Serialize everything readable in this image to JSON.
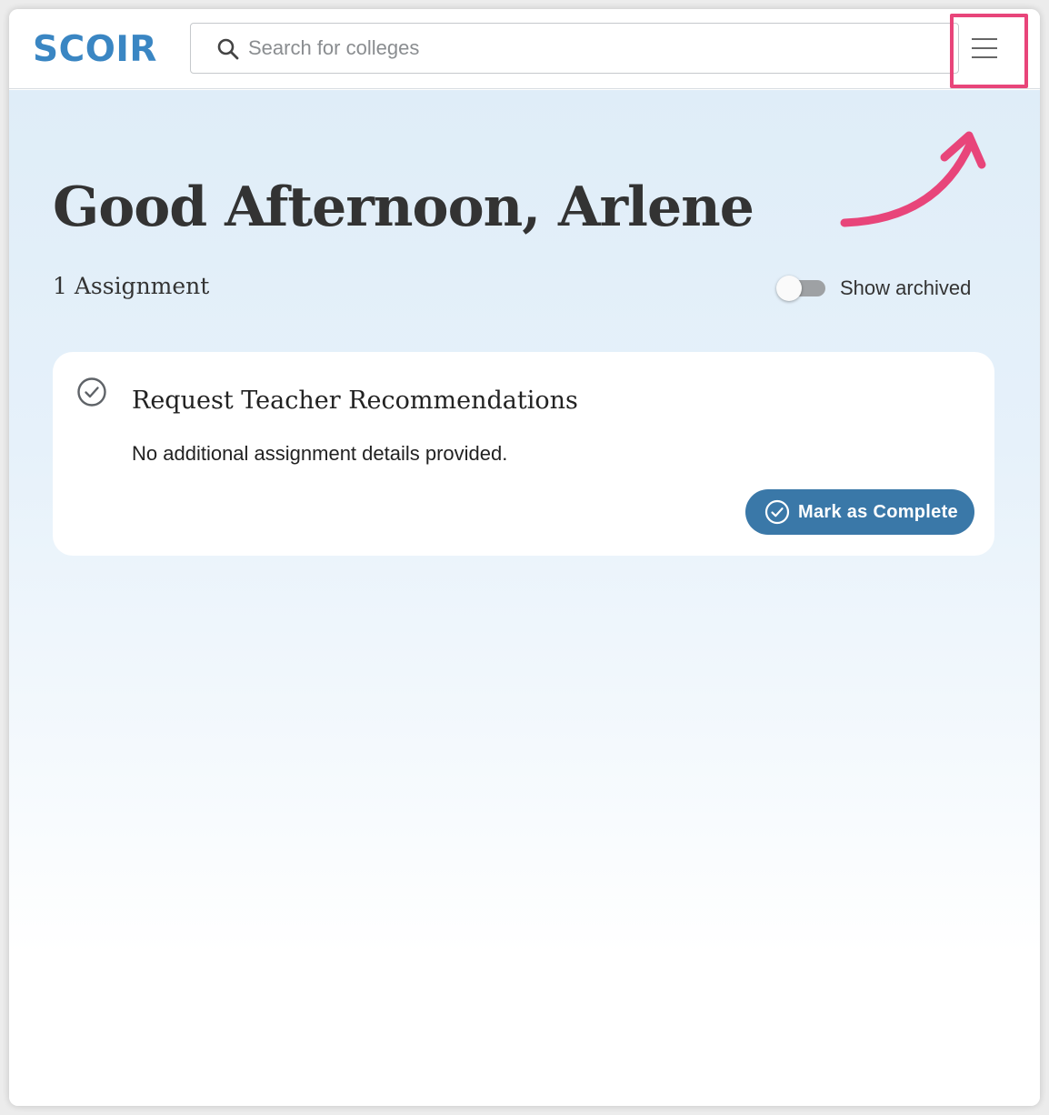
{
  "header": {
    "logo_text": "SCOIR",
    "search": {
      "placeholder": "Search for colleges",
      "value": ""
    },
    "menu_icon": "hamburger-menu-icon"
  },
  "greeting": {
    "prefix": "Good Afternoon, ",
    "name": "Arlene"
  },
  "assignments": {
    "count_label": "1 Assignment",
    "show_archived_label": "Show archived",
    "show_archived_on": false,
    "items": [
      {
        "title": "Request Teacher Recommendations",
        "description": "No additional assignment details provided.",
        "action_label": "Mark as Complete",
        "status_icon": "check-circle-icon"
      }
    ]
  },
  "annotation": {
    "highlight_color": "#e8457a",
    "arrow_icon": "curved-arrow-icon"
  },
  "colors": {
    "brand": "#3a86c3",
    "button": "#3a78a8"
  }
}
